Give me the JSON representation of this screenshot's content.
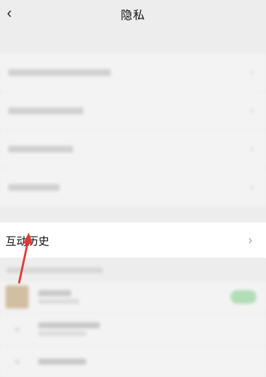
{
  "header": {
    "back_icon": "chevron-left-icon",
    "title": "隐私"
  },
  "interaction_history": {
    "label": "互动历史",
    "chevron_icon": "chevron-right-icon"
  },
  "colors": {
    "background": "#ededed",
    "card": "#ffffff",
    "annotation_arrow": "#e53935",
    "toggle_on": "#07c160"
  }
}
